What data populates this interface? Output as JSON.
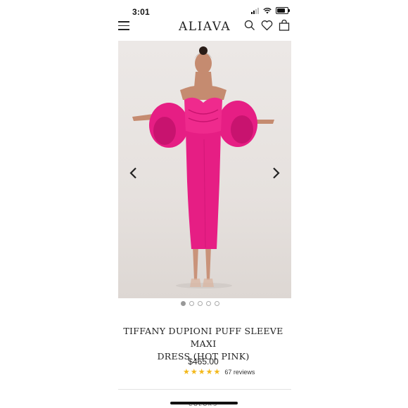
{
  "status_bar": {
    "time": "3:01"
  },
  "header": {
    "logo": "ALIAVA",
    "icons": [
      "menu-icon",
      "search-icon",
      "heart-icon",
      "bag-icon"
    ]
  },
  "carousel": {
    "image_count": 5,
    "active_index": 0,
    "prev_icon": "chevron-left-icon",
    "next_icon": "chevron-right-icon"
  },
  "product": {
    "title": "TIFFANY DUPIONI PUFF SLEEVE MAXI DRESS (HOT PINK)",
    "title_line1": "TIFFANY DUPIONI PUFF SLEEVE MAXI",
    "title_line2": "DRESS (HOT PINK)",
    "price": "$465.00",
    "rating": 5,
    "reviews": "67 reviews"
  },
  "options": {
    "colors_label": "COLORS"
  },
  "colors": {
    "dress": "#e61e84",
    "star": "#f3b81a"
  }
}
